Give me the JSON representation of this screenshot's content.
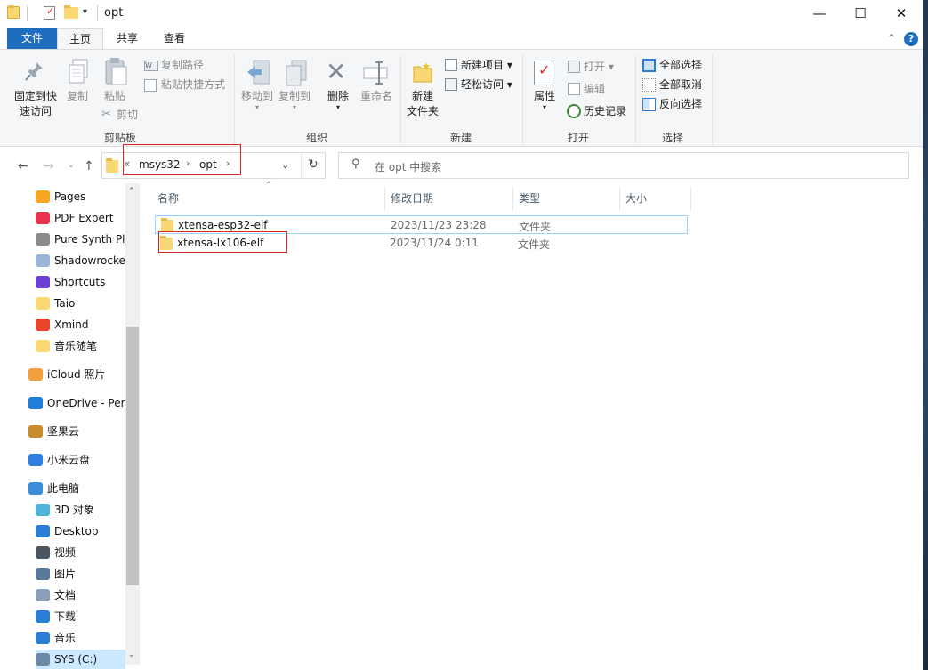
{
  "window": {
    "title": "opt",
    "controls": {
      "minimize": "—",
      "maximize": "☐",
      "close": "✕"
    }
  },
  "ribbon_tabs": [
    {
      "label": "文件",
      "active": false
    },
    {
      "label": "主页",
      "active": true
    },
    {
      "label": "共享",
      "active": false
    },
    {
      "label": "查看",
      "active": false
    }
  ],
  "ribbon": {
    "clipboard": {
      "group": "剪贴板",
      "pin_line1": "固定到快",
      "pin_line2": "速访问",
      "copy": "复制",
      "paste": "粘贴",
      "copy_path": "复制路径",
      "paste_shortcut": "粘贴快捷方式",
      "cut": "剪切"
    },
    "organize": {
      "group": "组织",
      "move_to": "移动到",
      "copy_to": "复制到",
      "delete": "删除",
      "rename": "重命名"
    },
    "new": {
      "group": "新建",
      "new_folder_line1": "新建",
      "new_folder_line2": "文件夹",
      "new_item": "新建项目",
      "easy_access": "轻松访问"
    },
    "open": {
      "group": "打开",
      "properties": "属性",
      "open": "打开",
      "edit": "编辑",
      "history": "历史记录"
    },
    "select": {
      "group": "选择",
      "select_all": "全部选择",
      "select_none": "全部取消",
      "invert": "反向选择"
    }
  },
  "address": {
    "overflow": "«",
    "crumbs": [
      "msys32",
      "opt"
    ],
    "search_placeholder": "在 opt 中搜索"
  },
  "nav_items": [
    {
      "label": "Pages",
      "icon": "pages-icon",
      "color": "#f5a623"
    },
    {
      "label": "PDF Expert",
      "icon": "pdf-expert-icon",
      "color": "#e8344e"
    },
    {
      "label": "Pure Synth Pla",
      "icon": "pure-synth-icon",
      "color": "#8a8a8a"
    },
    {
      "label": "Shadowrocke",
      "icon": "shadowrocket-icon",
      "color": "#9bb5d8"
    },
    {
      "label": "Shortcuts",
      "icon": "shortcuts-icon",
      "color": "#6b3fd6"
    },
    {
      "label": "Taio",
      "icon": "folder-icon",
      "color": "#f8d775"
    },
    {
      "label": "Xmind",
      "icon": "xmind-icon",
      "color": "#e8442a"
    },
    {
      "label": "音乐随笔",
      "icon": "folder-icon",
      "color": "#f8d775"
    },
    {
      "label": "iCloud 照片",
      "icon": "icloud-photos-icon",
      "color": "#f2a03d"
    },
    {
      "label": "OneDrive - Per",
      "icon": "onedrive-icon",
      "color": "#1f7fd8"
    },
    {
      "label": "坚果云",
      "icon": "jianguoyun-icon",
      "color": "#c98a2a"
    },
    {
      "label": "小米云盘",
      "icon": "mi-cloud-icon",
      "color": "#2f7fe0"
    },
    {
      "label": "此电脑",
      "icon": "this-pc-icon",
      "color": "#3a8fd8"
    },
    {
      "label": "3D 对象",
      "icon": "3d-objects-icon",
      "color": "#4fb3d9"
    },
    {
      "label": "Desktop",
      "icon": "desktop-icon",
      "color": "#2a7fd4"
    },
    {
      "label": "视频",
      "icon": "videos-icon",
      "color": "#4a5560"
    },
    {
      "label": "图片",
      "icon": "pictures-icon",
      "color": "#5a7a9a"
    },
    {
      "label": "文档",
      "icon": "documents-icon",
      "color": "#8aa0b8"
    },
    {
      "label": "下载",
      "icon": "downloads-icon",
      "color": "#2a7fd4"
    },
    {
      "label": "音乐",
      "icon": "music-icon",
      "color": "#2a7fd4"
    },
    {
      "label": "SYS (C:)",
      "icon": "drive-icon",
      "color": "#6a8aa8"
    }
  ],
  "columns": [
    "名称",
    "修改日期",
    "类型",
    "大小"
  ],
  "files": [
    {
      "name": "xtensa-esp32-elf",
      "date": "2023/11/23 23:28",
      "type": "文件夹",
      "size": ""
    },
    {
      "name": "xtensa-lx106-elf",
      "date": "2023/11/24 0:11",
      "type": "文件夹",
      "size": ""
    }
  ]
}
